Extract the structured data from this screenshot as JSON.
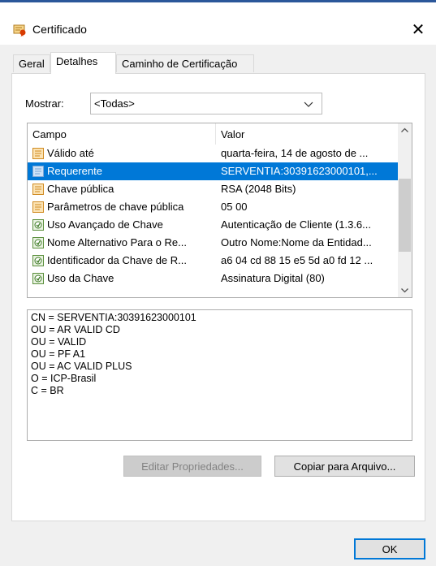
{
  "window": {
    "title": "Certificado",
    "title_icon": "certificate-icon",
    "close_label": "✕"
  },
  "tabs": [
    {
      "label": "Geral",
      "active": false
    },
    {
      "label": "Detalhes",
      "active": true
    },
    {
      "label": "Caminho de Certificação",
      "active": false
    }
  ],
  "show": {
    "label": "Mostrar:",
    "selected": "<Todas>"
  },
  "fields_list": {
    "columns": [
      "Campo",
      "Valor"
    ],
    "rows": [
      {
        "icon": "document-field-icon",
        "campo": "Válido até",
        "valor": "quarta-feira, 14 de agosto de ...",
        "selected": false
      },
      {
        "icon": "document-field-icon",
        "campo": "Requerente",
        "valor": "SERVENTIA:30391623000101,...",
        "selected": true
      },
      {
        "icon": "document-field-icon",
        "campo": "Chave pública",
        "valor": "RSA (2048 Bits)",
        "selected": false
      },
      {
        "icon": "document-field-icon",
        "campo": "Parâmetros de chave pública",
        "valor": "05 00",
        "selected": false
      },
      {
        "icon": "extension-field-icon",
        "campo": "Uso Avançado de Chave",
        "valor": "Autenticação de Cliente (1.3.6...",
        "selected": false
      },
      {
        "icon": "extension-field-icon",
        "campo": "Nome Alternativo Para o Re...",
        "valor": "Outro Nome:Nome da Entidad...",
        "selected": false
      },
      {
        "icon": "extension-field-icon",
        "campo": "Identificador da Chave de R...",
        "valor": "a6 04 cd 88 15 e5 5d a0 fd 12 ...",
        "selected": false
      },
      {
        "icon": "extension-field-icon",
        "campo": "Uso da Chave",
        "valor": "Assinatura Digital (80)",
        "selected": false
      }
    ]
  },
  "detail_lines": [
    "CN = SERVENTIA:30391623000101",
    "OU = AR VALID CD",
    "OU = VALID",
    "OU = PF A1",
    "OU = AC VALID PLUS",
    "O = ICP-Brasil",
    "C = BR"
  ],
  "buttons": {
    "edit_properties": "Editar Propriedades...",
    "copy_to_file": "Copiar para Arquivo...",
    "ok": "OK"
  },
  "colors": {
    "selection": "#0078d7",
    "dialog_bg": "#f0f0f0",
    "title_accent": "#2b579a"
  }
}
